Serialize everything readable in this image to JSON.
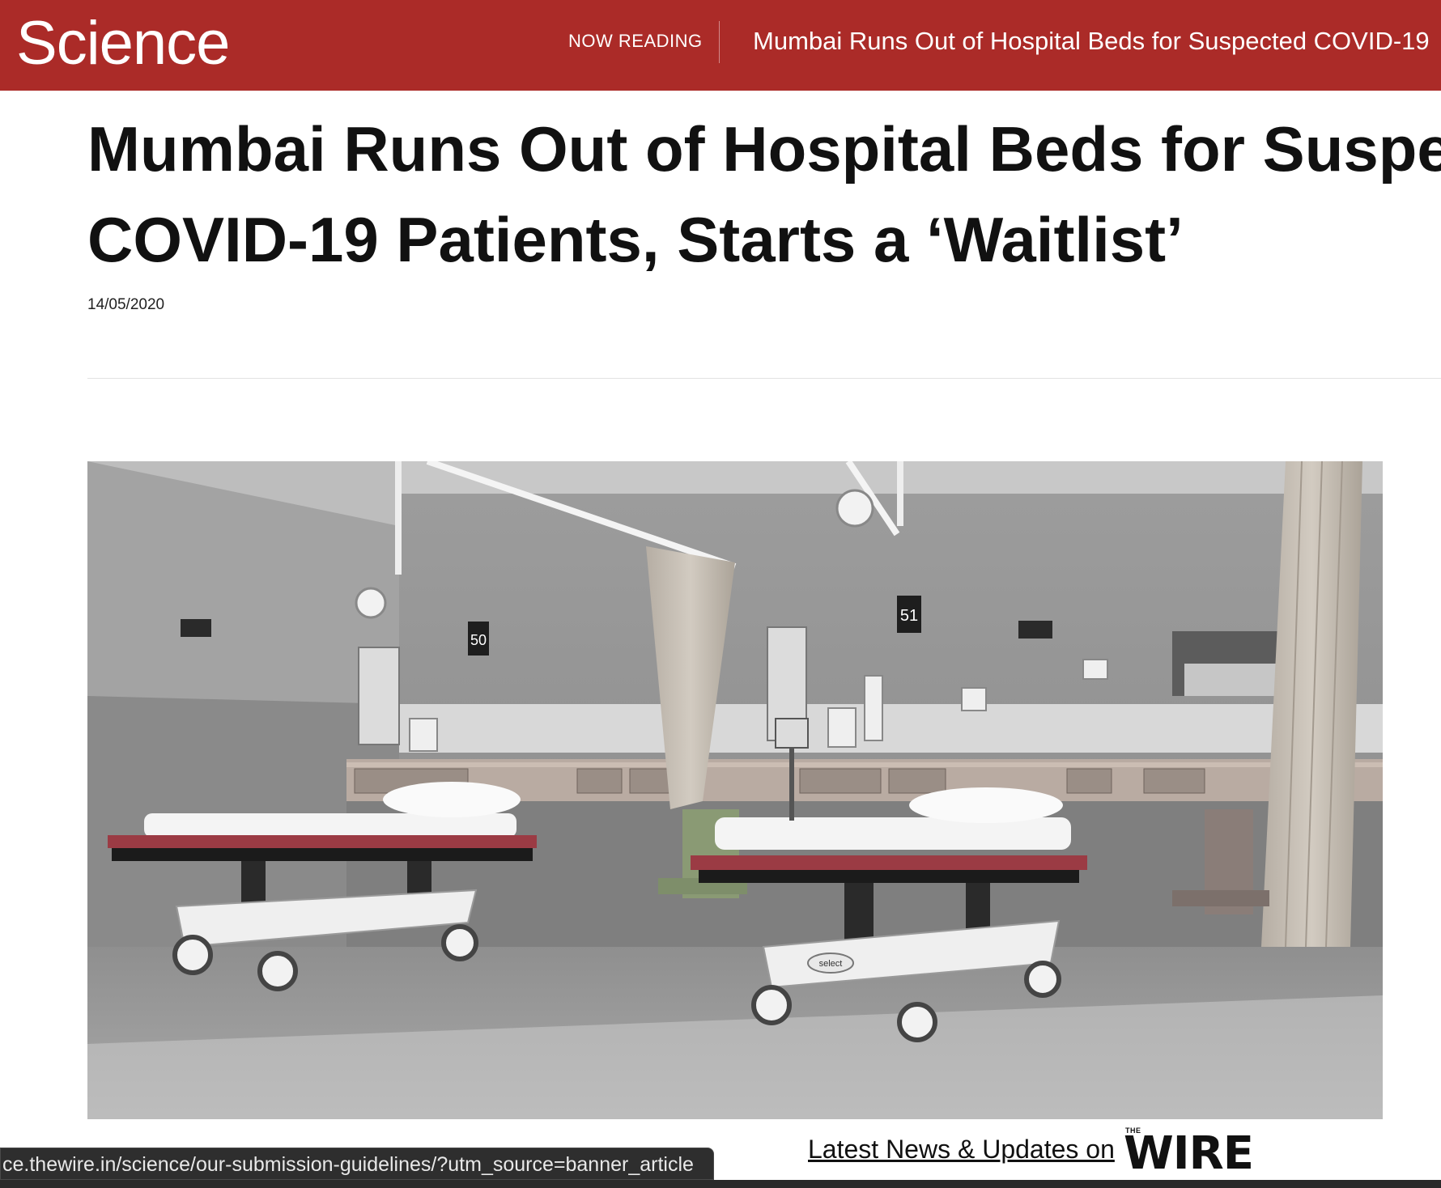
{
  "header": {
    "logo": "Science",
    "now_reading_label": "NOW READING",
    "now_reading_title": "Mumbai Runs Out of Hospital Beds for Suspected COVID-19"
  },
  "article": {
    "headline_line1": "Mumbai Runs Out of Hospital Beds for Suspect",
    "headline_line2": "COVID-19 Patients, Starts a ‘Waitlist’",
    "date": "14/05/2020",
    "hero_bed_numbers": [
      "50",
      "51"
    ],
    "hero_device_label": "select"
  },
  "footer": {
    "status_url": "ce.thewire.in/science/our-submission-guidelines/?utm_source=banner_article",
    "latest_news": "Latest News & Updates on",
    "brand_small": "THE",
    "brand_word": "WIRE"
  },
  "colors": {
    "header_bg": "#ab2b28",
    "text": "#111111"
  }
}
